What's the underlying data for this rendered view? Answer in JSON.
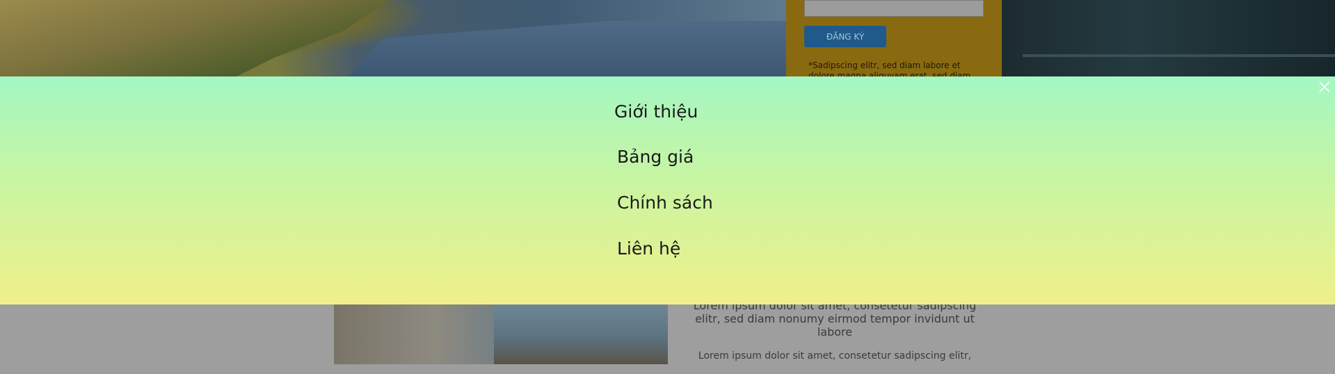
{
  "signup": {
    "button_label": "ĐĂNG KÝ",
    "note": "*Sadipscing elitr, sed diam labore et dolore magna aliquyam erat, sed diam"
  },
  "content": {
    "paragraph1": "Lorem ipsum dolor sit amet, consetetur sadipscing elitr, sed diam nonumy eirmod tempor invidunt ut labore",
    "paragraph2": "Lorem ipsum dolor sit amet, consetetur sadipscing elitr,"
  },
  "menu": {
    "close_icon": "close-icon",
    "items": [
      {
        "label": "Giới thiệu"
      },
      {
        "label": "Bảng giá"
      },
      {
        "label": "Chính sách"
      },
      {
        "label": "Liên hệ"
      }
    ]
  },
  "colors": {
    "overlay_top": "#a3f7c4",
    "overlay_bottom": "#f0f08a"
  }
}
